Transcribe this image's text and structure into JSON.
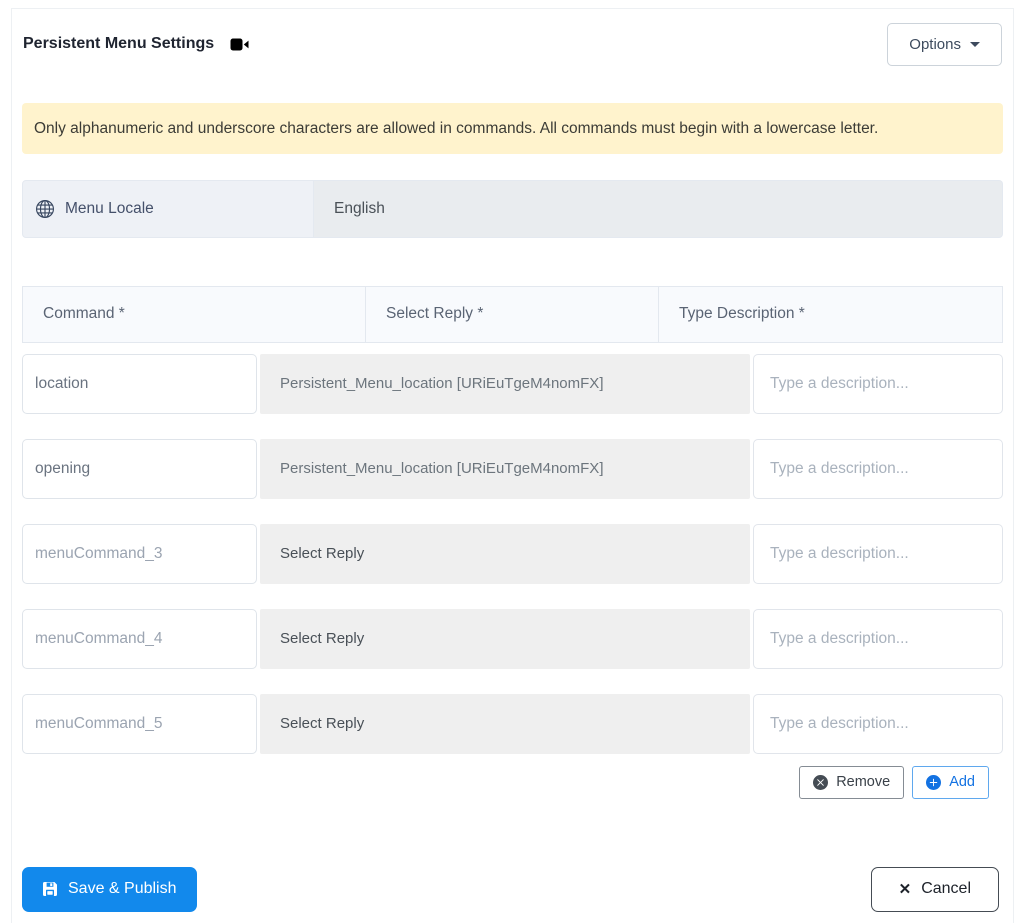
{
  "header": {
    "title": "Persistent Menu Settings",
    "options_button": "Options"
  },
  "alert": {
    "text": "Only alphanumeric and underscore characters are allowed in commands. All commands must begin with a lowercase letter."
  },
  "locale": {
    "label": "Menu Locale",
    "value": "English"
  },
  "table": {
    "headers": [
      "Command *",
      "Select Reply *",
      "Type Description *"
    ],
    "rows": [
      {
        "command": "location",
        "reply": "Persistent_Menu_location [URiEuTgeM4nomFX]",
        "description_placeholder": "Type a description..."
      },
      {
        "command": "opening",
        "reply": "Persistent_Menu_location [URiEuTgeM4nomFX]",
        "description_placeholder": "Type a description..."
      },
      {
        "command_placeholder": "menuCommand_3",
        "reply": "Select Reply",
        "description_placeholder": "Type a description..."
      },
      {
        "command_placeholder": "menuCommand_4",
        "reply": "Select Reply",
        "description_placeholder": "Type a description..."
      },
      {
        "command_placeholder": "menuCommand_5",
        "reply": "Select Reply",
        "description_placeholder": "Type a description..."
      }
    ],
    "actions": {
      "remove": "Remove",
      "add": "Add"
    }
  },
  "footer": {
    "save": "Save & Publish",
    "cancel": "Cancel"
  },
  "colors": {
    "primary_blue": "#1289ec",
    "add_blue": "#1372e2",
    "alert_bg": "#fff3cd",
    "table_header_bg": "#f8fafd",
    "reply_select_bg": "#efefef",
    "locale_label_bg": "#eef1f6",
    "locale_value_bg": "#e9ecef"
  }
}
